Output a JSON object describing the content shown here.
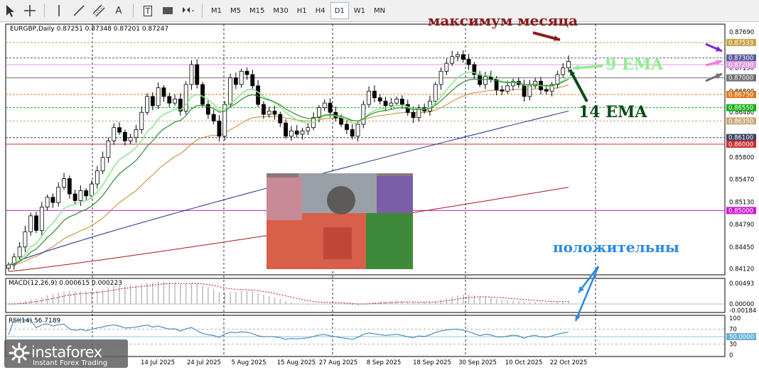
{
  "toolbar": {
    "tools": [
      {
        "name": "cursor-icon"
      },
      {
        "name": "crosshair-icon"
      },
      {
        "name": "vertical-line-icon"
      },
      {
        "name": "trendline-icon"
      },
      {
        "name": "channel-icon"
      },
      {
        "name": "text-icon",
        "label": "A"
      },
      {
        "name": "text-label-icon",
        "label": "T"
      },
      {
        "name": "rectangle-icon"
      },
      {
        "name": "arrows-icon"
      }
    ],
    "timeframes": [
      "M1",
      "M5",
      "M15",
      "M30",
      "H1",
      "H4",
      "D1",
      "W1",
      "MN"
    ],
    "active_timeframe": "D1"
  },
  "header": {
    "symbol_info": "EURGBP,Daily  0.87251 0.87348 0.87201 0.87247"
  },
  "annotations": {
    "month_max": "максимум месяца",
    "ema9": "9 EMA",
    "ema14": "14 EMA",
    "positive": "положительны"
  },
  "macd": {
    "label": "MACD(12,26,9) 0.000615 0.000223",
    "axis": [
      "0.00493",
      "0.00000",
      "-0.00184"
    ]
  },
  "rsi": {
    "label": "RSI(14) 56.7189",
    "axis": [
      "100",
      "70",
      "50.0000",
      "30",
      "0"
    ]
  },
  "logo": {
    "name": "instaforex",
    "sub": "Instant Forex Trading"
  },
  "colors": {
    "ema9": "#8fe88f",
    "ema14": "#2f8a2f",
    "orange_ma": "#c8862a",
    "navy_ma": "#1a2a8c",
    "red_ma": "#a81818",
    "month_max": "#8b1a1a",
    "ema9_text": "#90ee90",
    "ema14_text": "#0b4a1a",
    "positive": "#2a8ae0"
  },
  "chart_data": {
    "type": "candlestick",
    "symbol": "EURGBP",
    "timeframe": "Daily",
    "x_tick_labels": [
      "14 Jul 2025",
      "24 Jul 2025",
      "5 Aug 2025",
      "15 Aug 2025",
      "27 Aug 2025",
      "8 Sep 2025",
      "18 Sep 2025",
      "30 Sep 2025",
      "10 Oct 2025",
      "22 Oct 2025"
    ],
    "price_axis_labels": [
      "0.87690",
      "0.87150",
      "0.86800",
      "0.86480",
      "0.86120",
      "0.85800",
      "0.85470",
      "0.85130",
      "0.84790",
      "0.84450",
      "0.84120"
    ],
    "ylim": [
      0.8403,
      0.8781
    ],
    "hlines": [
      {
        "value": 0.87533,
        "label": "0.87533",
        "color": "#c8a24a",
        "style": "dashed"
      },
      {
        "value": 0.873,
        "label": "0.87300",
        "color": "#5a5a9a",
        "style": "dashed"
      },
      {
        "value": 0.872,
        "label": "0.87200",
        "color": "#e09ae0",
        "style": "solid"
      },
      {
        "value": 0.87,
        "label": "0.87000",
        "color": "#707070",
        "style": "solid"
      },
      {
        "value": 0.8675,
        "label": "0.86750",
        "color": "#e07818",
        "style": "dashed"
      },
      {
        "value": 0.8655,
        "label": "0.86550",
        "color": "#18b018",
        "style": "dashed"
      },
      {
        "value": 0.8635,
        "label": "0.86350",
        "color": "#c8a878",
        "style": "dashed"
      },
      {
        "value": 0.861,
        "label": "0.86100",
        "color": "#404060",
        "style": "dashed"
      },
      {
        "value": 0.86,
        "label": "0.86000",
        "color": "#c83030",
        "style": "solid"
      },
      {
        "value": 0.85,
        "label": "0.85000",
        "color": "#d018d0",
        "style": "solid"
      }
    ],
    "closes": [
      0.8418,
      0.843,
      0.8445,
      0.8468,
      0.8492,
      0.847,
      0.8505,
      0.852,
      0.8512,
      0.8535,
      0.8548,
      0.8525,
      0.8515,
      0.853,
      0.8522,
      0.854,
      0.856,
      0.858,
      0.8605,
      0.8625,
      0.8618,
      0.8605,
      0.861,
      0.8622,
      0.8648,
      0.8672,
      0.8658,
      0.8685,
      0.8672,
      0.8662,
      0.8668,
      0.865,
      0.869,
      0.872,
      0.869,
      0.866,
      0.8645,
      0.8635,
      0.8612,
      0.866,
      0.87,
      0.869,
      0.871,
      0.8705,
      0.8688,
      0.866,
      0.8645,
      0.865,
      0.8645,
      0.8632,
      0.8612,
      0.862,
      0.8615,
      0.862,
      0.8625,
      0.864,
      0.8655,
      0.8662,
      0.8648,
      0.864,
      0.863,
      0.8622,
      0.8612,
      0.863,
      0.866,
      0.868,
      0.867,
      0.8665,
      0.8658,
      0.8662,
      0.8668,
      0.866,
      0.8648,
      0.864,
      0.8655,
      0.865,
      0.8665,
      0.869,
      0.871,
      0.8722,
      0.8732,
      0.8735,
      0.8728,
      0.872,
      0.8705,
      0.869,
      0.8702,
      0.8698,
      0.8682,
      0.868,
      0.8688,
      0.8695,
      0.869,
      0.8672,
      0.8688,
      0.8695,
      0.8682,
      0.868,
      0.869,
      0.8705,
      0.8715,
      0.8725
    ],
    "series": [
      {
        "name": "9 EMA",
        "type": "line"
      },
      {
        "name": "14 EMA",
        "type": "line"
      }
    ]
  }
}
